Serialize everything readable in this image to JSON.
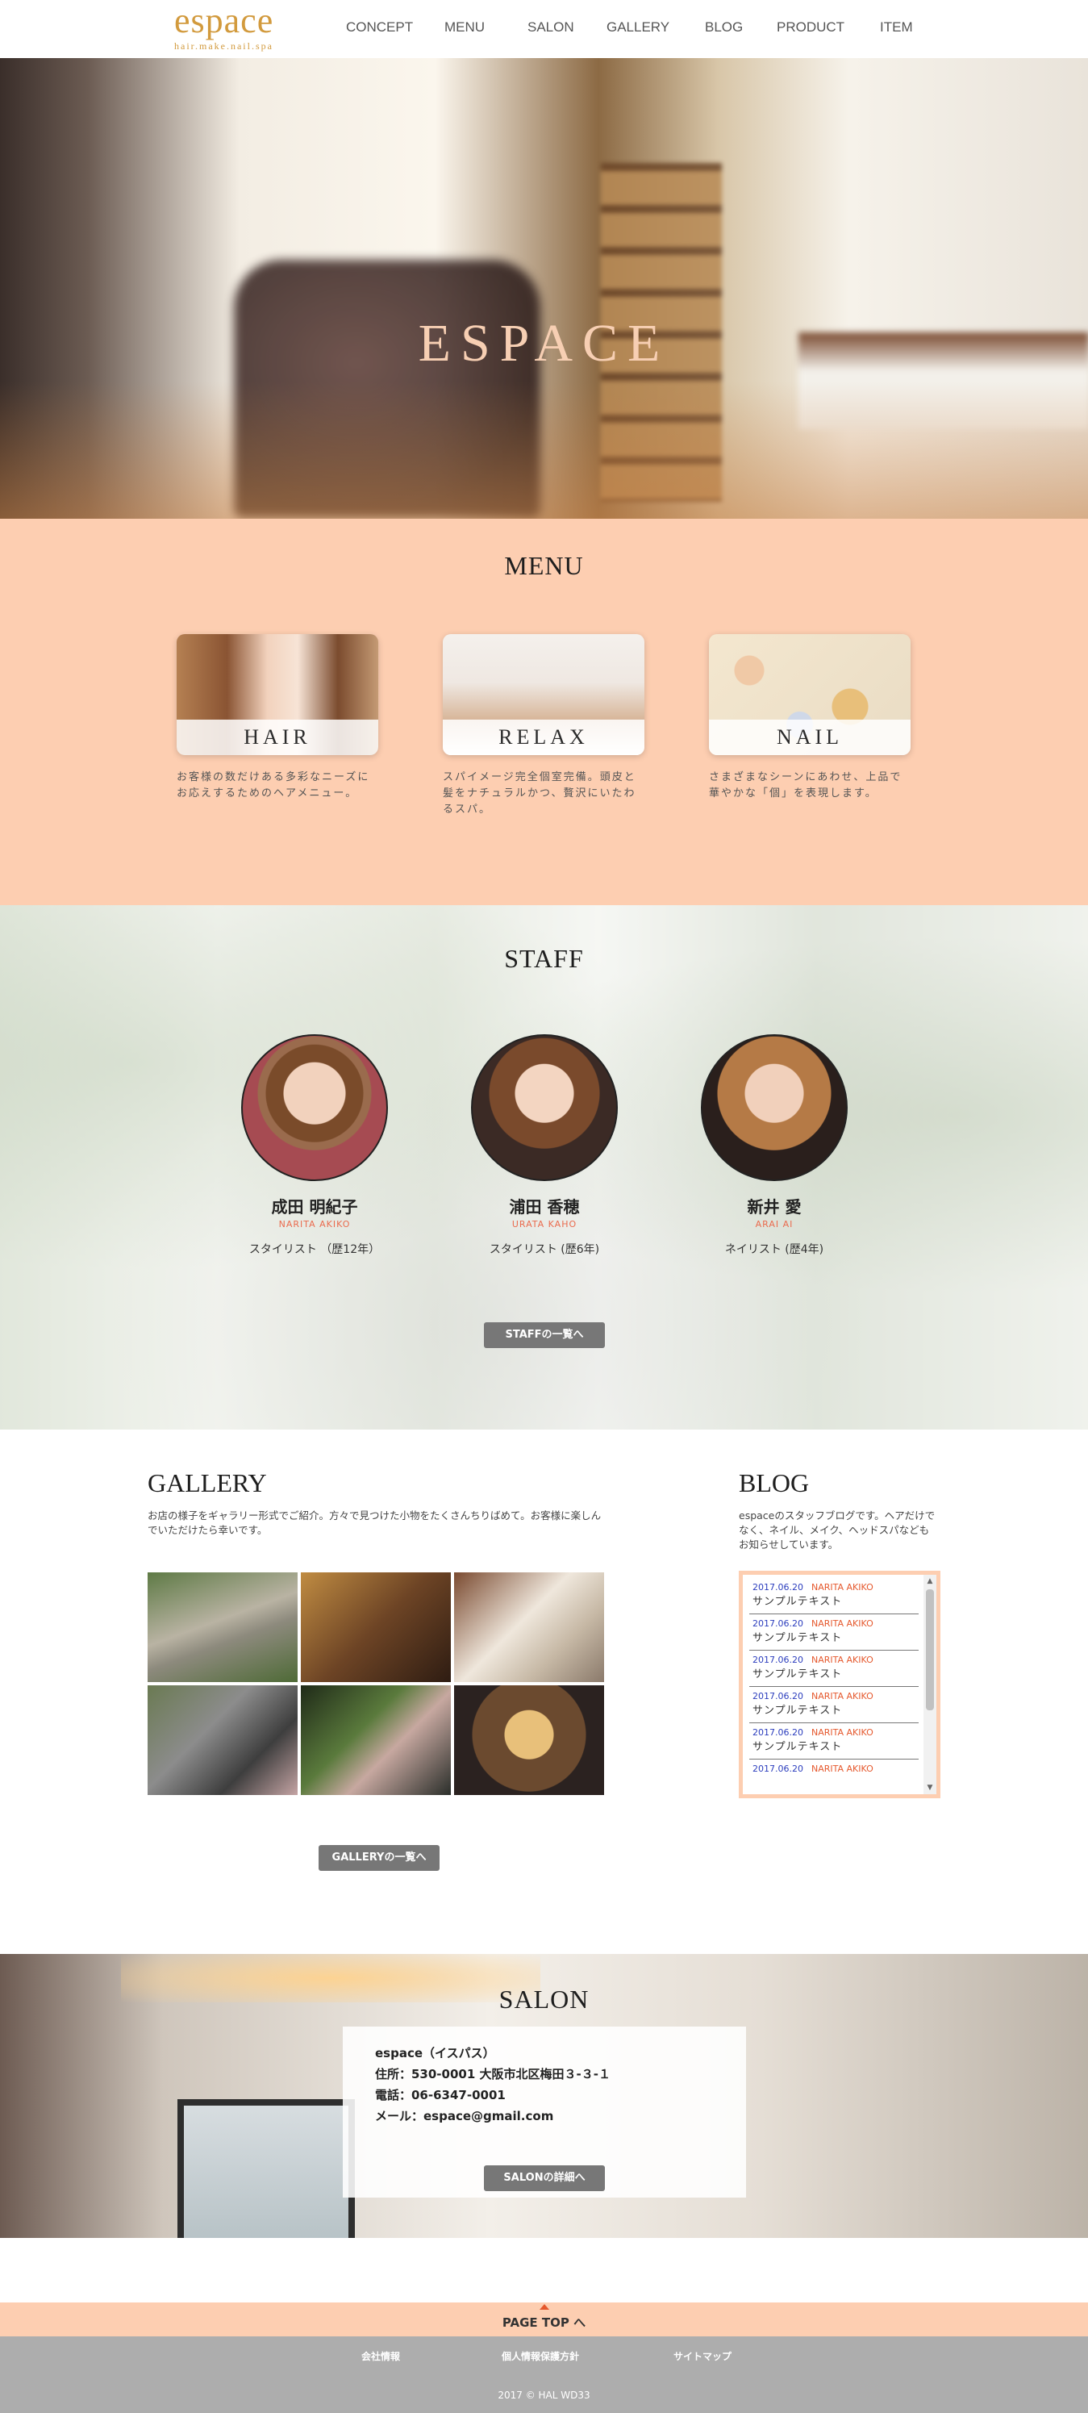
{
  "header": {
    "logo_name": "espace",
    "logo_tagline": "hair.make.nail.spa",
    "nav": [
      "CONCEPT",
      "MENU",
      "SALON",
      "GALLERY",
      "BLOG",
      "PRODUCT",
      "ITEM"
    ]
  },
  "hero": {
    "title": "ESPACE"
  },
  "menu": {
    "title": "MENU",
    "cards": [
      {
        "label": "HAIR",
        "desc": "お客様の数だけある多彩なニーズにお応えするためのヘアメニュー。"
      },
      {
        "label": "RELAX",
        "desc": "スパイメージ完全個室完備。頭皮と髪をナチュラルかつ、贅沢にいたわるスパ。"
      },
      {
        "label": "NAIL",
        "desc": "さまざまなシーンにあわせ、上品で華やかな「個」を表現します。"
      }
    ]
  },
  "staff": {
    "title": "STAFF",
    "members": [
      {
        "name_jp": "成田 明紀子",
        "name_romaji": "NARITA AKIKO",
        "role": "スタイリスト （歴12年）"
      },
      {
        "name_jp": "浦田 香穂",
        "name_romaji": "URATA KAHO",
        "role": "スタイリスト (歴6年)"
      },
      {
        "name_jp": "新井 愛",
        "name_romaji": "ARAI AI",
        "role": "ネイリスト (歴4年)"
      }
    ],
    "button": "STAFFの一覧へ"
  },
  "gallery": {
    "title": "GALLERY",
    "desc": "お店の様子をギャラリー形式でご紹介。方々で見つけた小物をたくさんちりばめて。お客様に楽しんでいただけたら幸いです。",
    "button": "GALLERYの一覧へ"
  },
  "blog": {
    "title": "BLOG",
    "desc": "espaceのスタッフブログです。ヘアだけでなく、ネイル、メイク、ヘッドスパなどもお知らせしています。",
    "entries": [
      {
        "date": "2017.06.20",
        "author": "NARITA AKIKO",
        "text": "サンプルテキスト"
      },
      {
        "date": "2017.06.20",
        "author": "NARITA AKIKO",
        "text": "サンプルテキスト"
      },
      {
        "date": "2017.06.20",
        "author": "NARITA AKIKO",
        "text": "サンプルテキスト"
      },
      {
        "date": "2017.06.20",
        "author": "NARITA AKIKO",
        "text": "サンプルテキスト"
      },
      {
        "date": "2017.06.20",
        "author": "NARITA AKIKO",
        "text": "サンプルテキスト"
      },
      {
        "date": "2017.06.20",
        "author": "NARITA AKIKO",
        "text": ""
      }
    ]
  },
  "salon": {
    "title": "SALON",
    "name": "espace（イスパス）",
    "address": "住所：530-0001 大阪市北区梅田３-３-１",
    "phone": "電話：06-6347-0001",
    "email": "メール：espace@gmail.com",
    "button": "SALONの詳細へ"
  },
  "pagetop": "PAGE TOP へ",
  "footer": {
    "links": [
      "会社情報",
      "個人情報保護方針",
      "サイトマップ"
    ],
    "copyright": "2017 © HAL WD33"
  },
  "colors": {
    "accent": "#fdceb1",
    "brand": "#d29a3d",
    "button": "#777777",
    "footer": "#adadad"
  }
}
